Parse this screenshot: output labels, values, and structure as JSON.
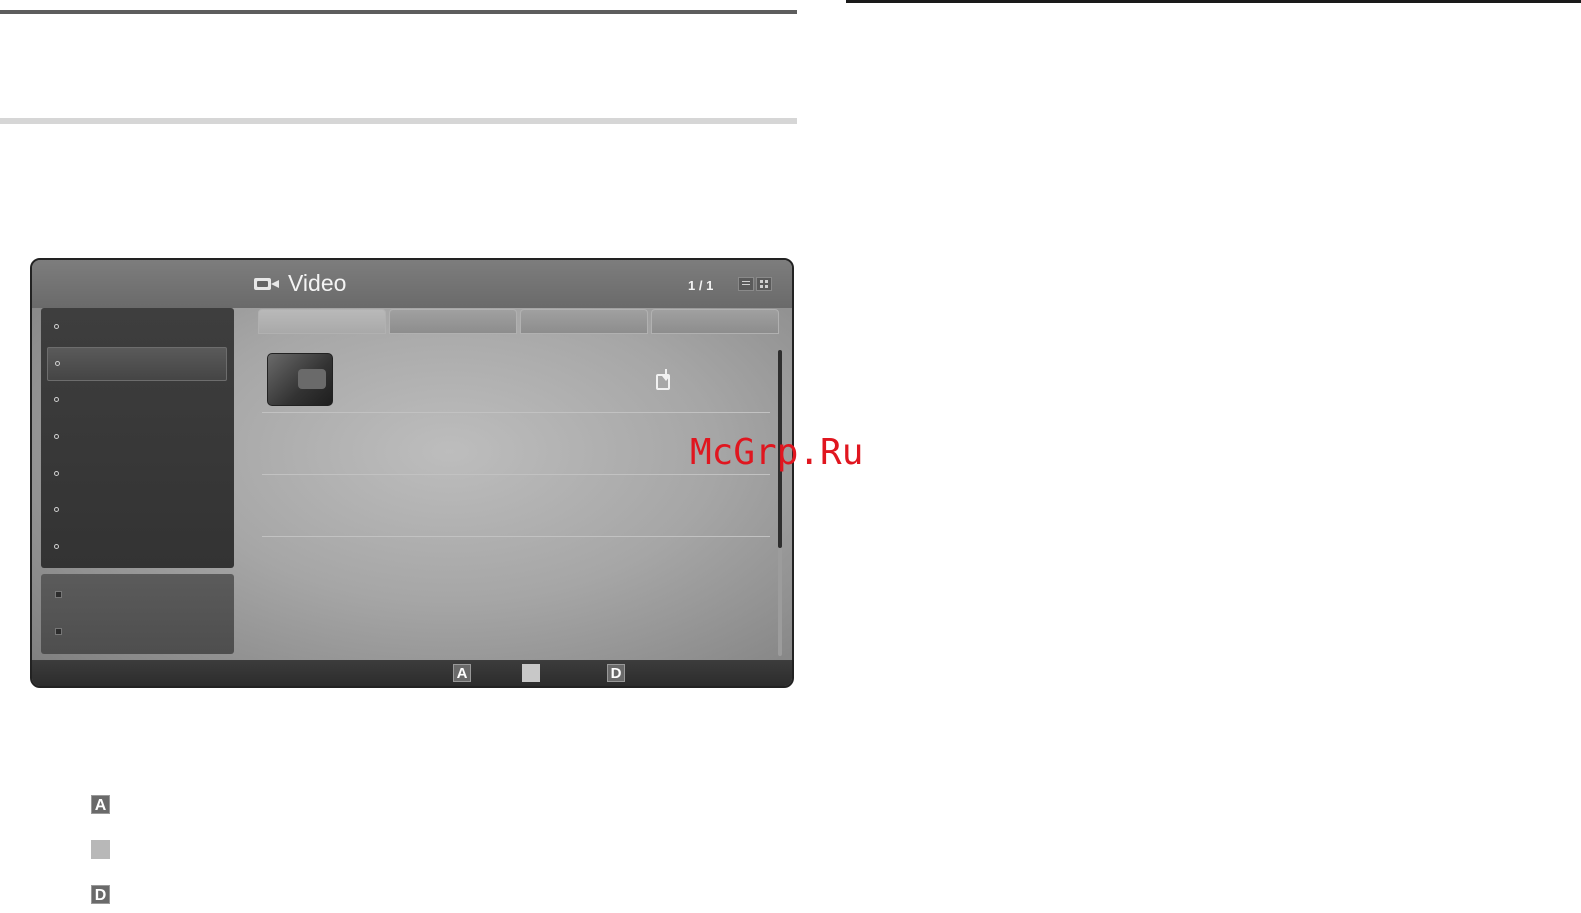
{
  "screen": {
    "title": "Video",
    "title_icon": "video-camera-icon",
    "page_count": "1 / 1",
    "view_modes": [
      "list-view-icon",
      "grid-view-icon"
    ]
  },
  "sidebar": {
    "item_count": 7,
    "selected_index": 1,
    "lower_item_count": 2
  },
  "tabs": {
    "count": 4,
    "active_index": 0
  },
  "content": {
    "row_icon": "file-download-icon",
    "scroll_fraction_visible": 0.65
  },
  "bottom_bar": {
    "keys": [
      "A",
      "",
      "D"
    ]
  },
  "watermark": {
    "text": "McGrp.Ru",
    "color": "#e0161f"
  },
  "legend": {
    "keys": [
      "A",
      "",
      "D"
    ]
  }
}
